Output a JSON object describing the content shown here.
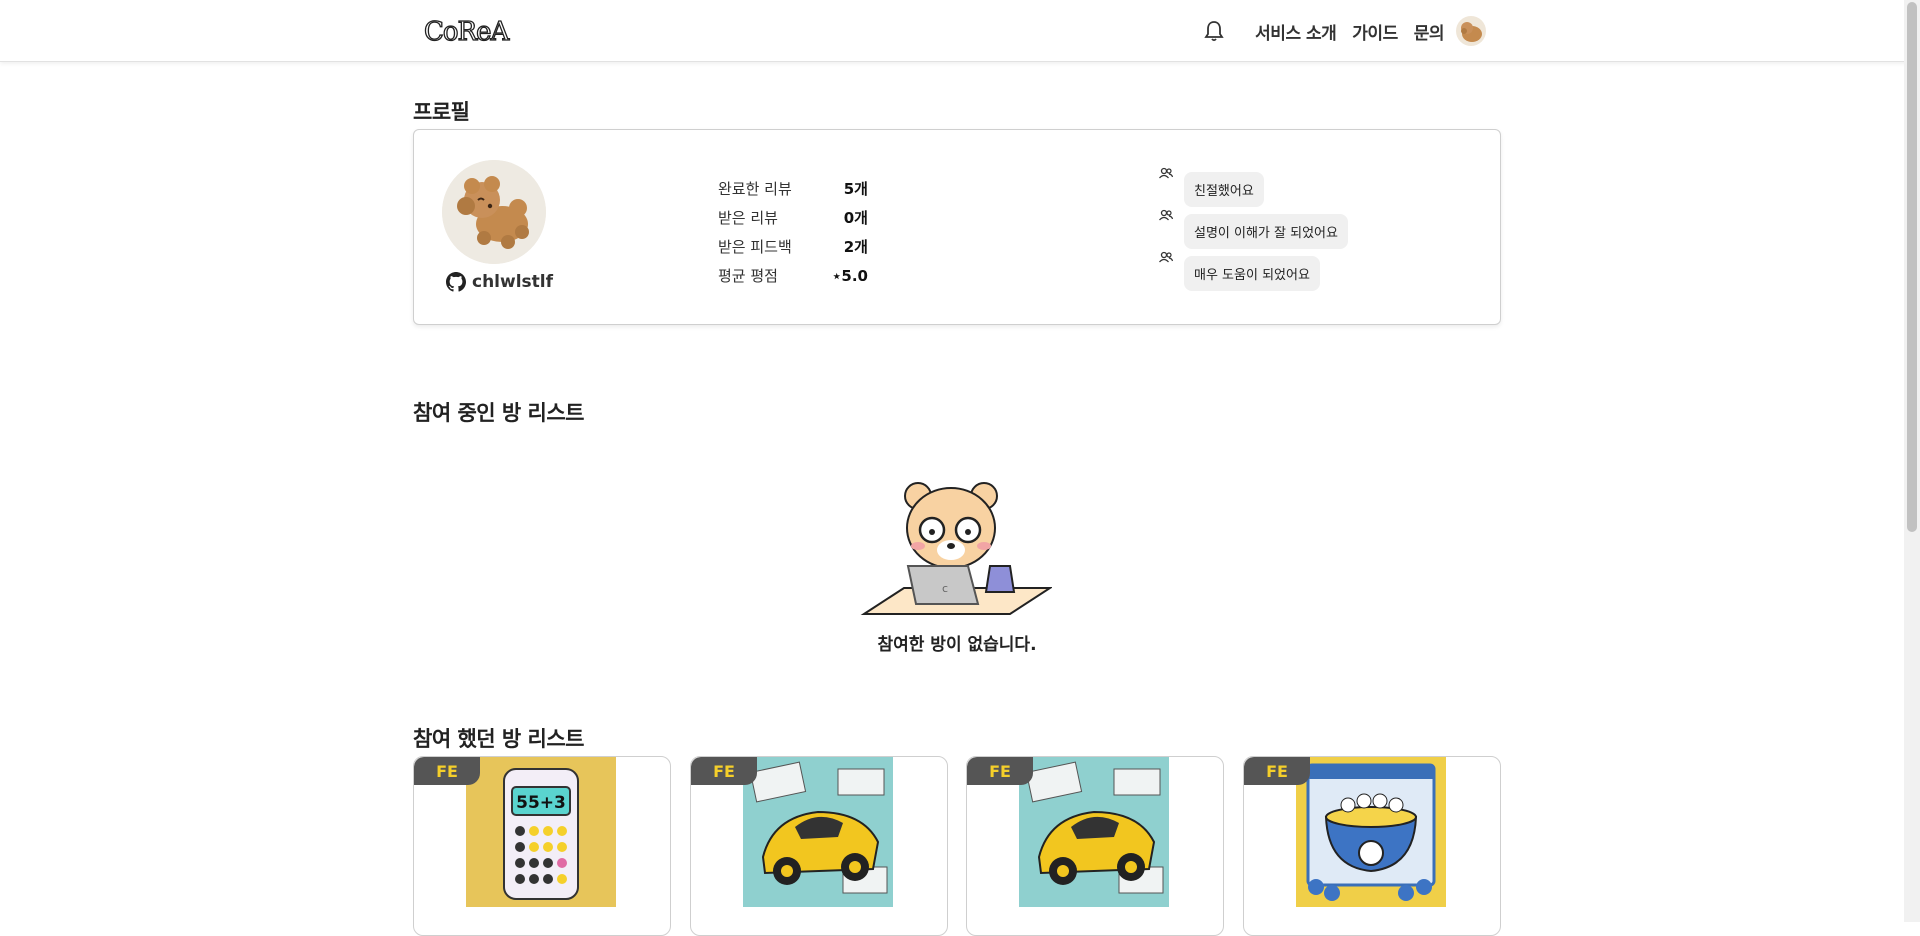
{
  "header": {
    "logo_text": "CoReA",
    "nav": [
      "서비스 소개",
      "가이드",
      "문의"
    ]
  },
  "profile": {
    "section_title": "프로필",
    "username": "chlwlstlf",
    "stats": [
      {
        "label": "완료한 리뷰",
        "value": "5개"
      },
      {
        "label": "받은 리뷰",
        "value": "0개"
      },
      {
        "label": "받은 피드백",
        "value": "2개"
      },
      {
        "label": "평균 평점",
        "value": "⋆5.0"
      }
    ],
    "feedback_keywords": [
      "친절했어요",
      "설명이 이해가 잘 되었어요",
      "매우 도움이 되었어요"
    ]
  },
  "participating": {
    "section_title": "참여 중인 방 리스트",
    "empty_message": "참여한 방이 없습니다."
  },
  "participated": {
    "section_title": "참여 했던 방 리스트",
    "rooms": [
      {
        "badge": "FE",
        "thumb": "calculator"
      },
      {
        "badge": "FE",
        "thumb": "racing-car"
      },
      {
        "badge": "FE",
        "thumb": "racing-car"
      },
      {
        "badge": "FE",
        "thumb": "lotto-cup"
      }
    ]
  },
  "colors": {
    "badge_bg": "#555555",
    "badge_text": "#f5cf2a",
    "chip_bg": "#f0f0f0"
  }
}
